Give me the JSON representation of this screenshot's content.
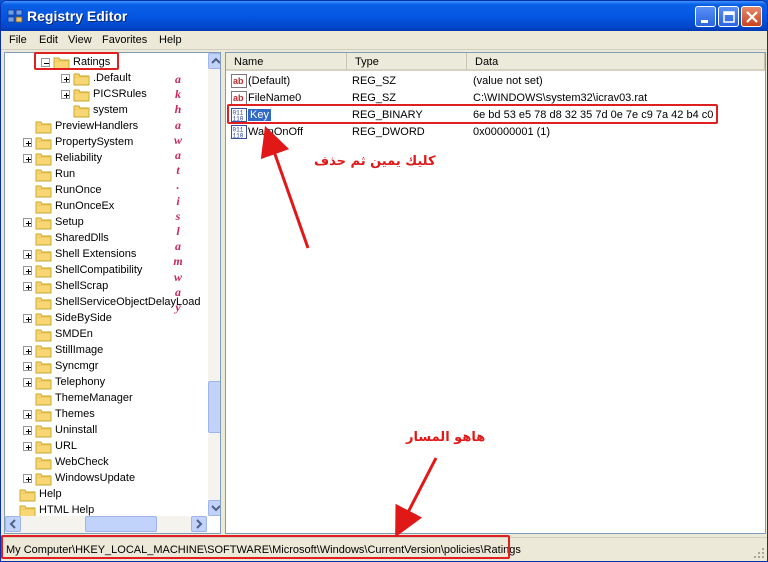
{
  "window": {
    "title": "Registry Editor"
  },
  "titlebar_buttons": [
    "minimize",
    "maximize",
    "close"
  ],
  "menu": [
    "File",
    "Edit",
    "View",
    "Favorites",
    "Help"
  ],
  "tree": {
    "items": [
      {
        "label": "Ratings",
        "expander": "minus",
        "indent": 1,
        "selected_box": true
      },
      {
        "label": ".Default",
        "expander": "plus",
        "indent": 2
      },
      {
        "label": "PICSRules",
        "expander": "plus",
        "indent": 2
      },
      {
        "label": "system",
        "expander": "none",
        "indent": 2
      },
      {
        "label": "PreviewHandlers",
        "expander": "none",
        "indent": 0
      },
      {
        "label": "PropertySystem",
        "expander": "plus",
        "indent": 0
      },
      {
        "label": "Reliability",
        "expander": "plus",
        "indent": 0
      },
      {
        "label": "Run",
        "expander": "none",
        "indent": 0
      },
      {
        "label": "RunOnce",
        "expander": "none",
        "indent": 0
      },
      {
        "label": "RunOnceEx",
        "expander": "none",
        "indent": 0
      },
      {
        "label": "Setup",
        "expander": "plus",
        "indent": 0
      },
      {
        "label": "SharedDlls",
        "expander": "none",
        "indent": 0
      },
      {
        "label": "Shell Extensions",
        "expander": "plus",
        "indent": 0
      },
      {
        "label": "ShellCompatibility",
        "expander": "plus",
        "indent": 0
      },
      {
        "label": "ShellScrap",
        "expander": "plus",
        "indent": 0
      },
      {
        "label": "ShellServiceObjectDelayLoad",
        "expander": "none",
        "indent": 0
      },
      {
        "label": "SideBySide",
        "expander": "plus",
        "indent": 0
      },
      {
        "label": "SMDEn",
        "expander": "none",
        "indent": 0
      },
      {
        "label": "StillImage",
        "expander": "plus",
        "indent": 0
      },
      {
        "label": "Syncmgr",
        "expander": "plus",
        "indent": 0
      },
      {
        "label": "Telephony",
        "expander": "plus",
        "indent": 0
      },
      {
        "label": "ThemeManager",
        "expander": "none",
        "indent": 0
      },
      {
        "label": "Themes",
        "expander": "plus",
        "indent": 0
      },
      {
        "label": "Uninstall",
        "expander": "plus",
        "indent": 0
      },
      {
        "label": "URL",
        "expander": "plus",
        "indent": 0
      },
      {
        "label": "WebCheck",
        "expander": "none",
        "indent": 0
      },
      {
        "label": "WindowsUpdate",
        "expander": "plus",
        "indent": 0
      },
      {
        "label": "Help",
        "expander": "none",
        "indent": -1
      },
      {
        "label": "HTML Help",
        "expander": "none",
        "indent": -1
      }
    ]
  },
  "list": {
    "columns": [
      "Name",
      "Type",
      "Data"
    ],
    "rows": [
      {
        "name": "(Default)",
        "type": "REG_SZ",
        "data": "(value not set)",
        "icon": "string-value-icon"
      },
      {
        "name": "FileName0",
        "type": "REG_SZ",
        "data": "C:\\WINDOWS\\system32\\icrav03.rat",
        "icon": "string-value-icon"
      },
      {
        "name": "Key",
        "type": "REG_BINARY",
        "data": "6e bd 53 e5 78 d8 32 35 7d 0e 7e c9 7a 42 b4 c0",
        "icon": "binary-value-icon",
        "selected": true
      },
      {
        "name": "WarnOnOff",
        "type": "REG_DWORD",
        "data": "0x00000001 (1)",
        "icon": "binary-value-icon"
      }
    ]
  },
  "status": {
    "path": "My Computer\\HKEY_LOCAL_MACHINE\\SOFTWARE\\Microsoft\\Windows\\CurrentVersion\\policies\\Ratings"
  },
  "annotations": {
    "vertical_letters": [
      "a",
      "k",
      "h",
      "a",
      "w",
      "a",
      "t",
      ".",
      "i",
      "s",
      "l",
      "a",
      "m",
      "w",
      "a",
      "y"
    ],
    "right_click_delete": "كليك يمين ثم حذف",
    "this_is_the_path": "هاهو المسار",
    "color": "#e01818"
  },
  "colors": {
    "selection": "#316ac5",
    "titlebar": "#0457e3",
    "annotation_red": "#e02020"
  }
}
